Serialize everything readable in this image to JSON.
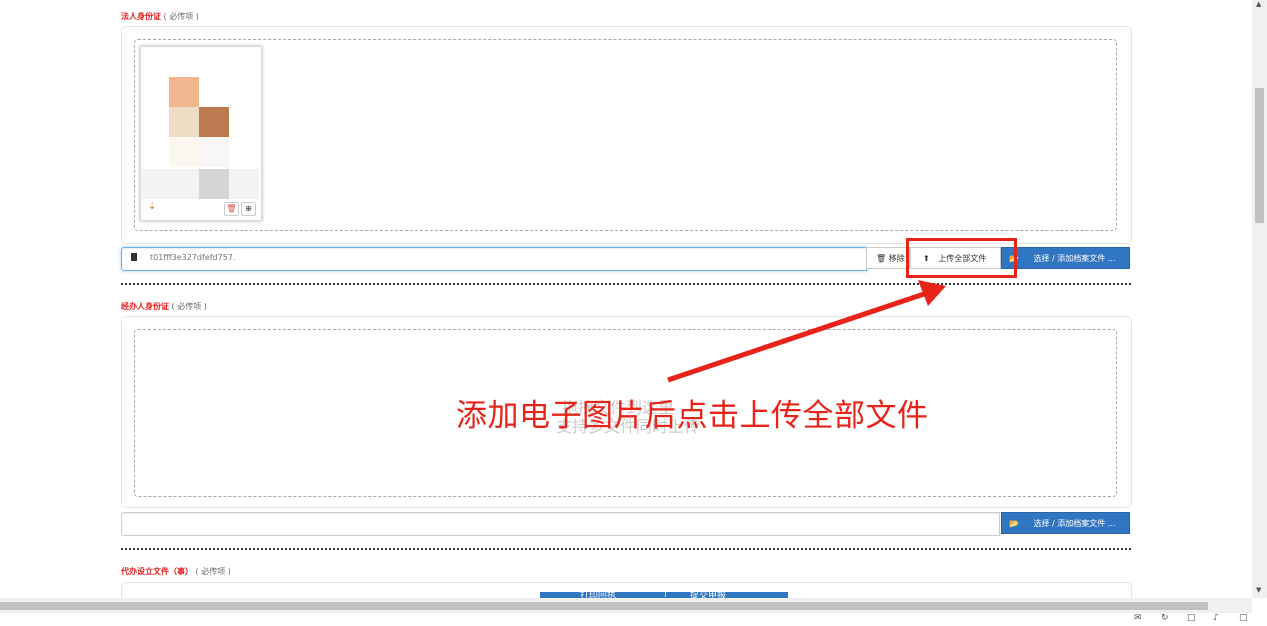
{
  "sections": [
    {
      "title": "法人身份证",
      "hint": "( 必传项 )"
    },
    {
      "title": "经办人身份证",
      "hint": "( 必传项 )"
    },
    {
      "title": "代办设立文件（事）",
      "hint": "( 必传项 )"
    }
  ],
  "upload1": {
    "filename": "t01fff3e327dfefd757.",
    "remove_label": "移除",
    "upload_all_label": "上传全部文件",
    "browse_label": "选择 / 添加档案文件 ..."
  },
  "upload2": {
    "drop_hint_line1": "拖拽文件到这里",
    "drop_hint_line2": "支持多文件同时上传",
    "browse_label": "选择 / 添加档案文件 ..."
  },
  "annotation": {
    "text": "添加电子图片后点击上传全部文件",
    "color": "#e8231a"
  },
  "bottom_buttons": [
    "打印回执",
    "提交申报"
  ],
  "colors": {
    "primary": "#3176c3",
    "required": "#e0201f"
  }
}
